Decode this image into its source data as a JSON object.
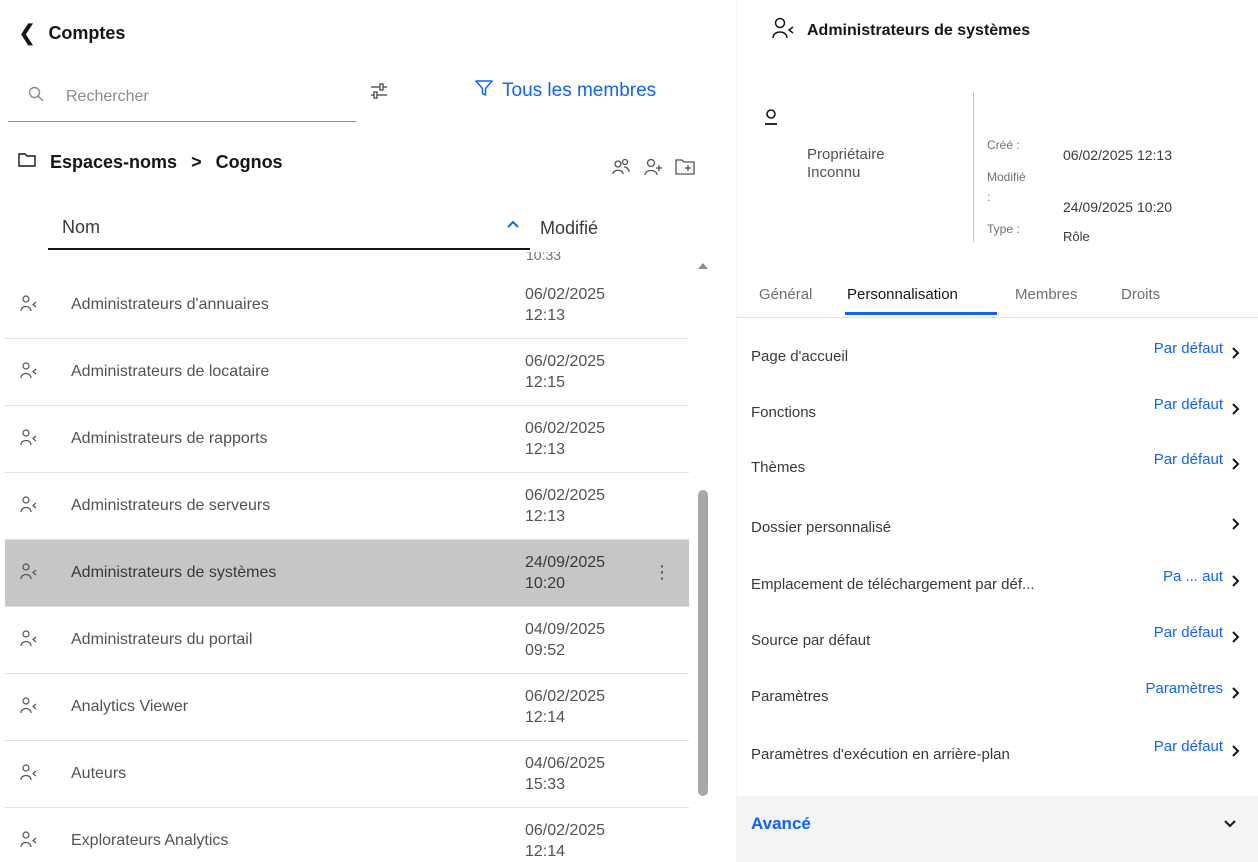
{
  "left": {
    "title": "Comptes",
    "search_placeholder": "Rechercher",
    "members_filter": "Tous les membres",
    "breadcrumb": {
      "root": "Espaces-noms",
      "separator": ">",
      "current": "Cognos"
    },
    "columns": {
      "name": "Nom",
      "modified": "Modifié"
    },
    "clipped_prev_time": "10:33",
    "rows": [
      {
        "name": "Administrateurs d'annuaires",
        "date": "06/02/2025",
        "time": "12:13"
      },
      {
        "name": "Administrateurs de locataire",
        "date": "06/02/2025",
        "time": "12:15"
      },
      {
        "name": "Administrateurs de rapports",
        "date": "06/02/2025",
        "time": "12:13"
      },
      {
        "name": "Administrateurs de serveurs",
        "date": "06/02/2025",
        "time": "12:13"
      },
      {
        "name": "Administrateurs de systèmes",
        "date": "24/09/2025",
        "time": "10:20",
        "selected": true
      },
      {
        "name": "Administrateurs du portail",
        "date": "04/09/2025",
        "time": "09:52"
      },
      {
        "name": "Analytics Viewer",
        "date": "06/02/2025",
        "time": "12:14"
      },
      {
        "name": "Auteurs",
        "date": "04/06/2025",
        "time": "15:33"
      },
      {
        "name": "Explorateurs Analytics",
        "date": "06/02/2025",
        "time": "12:14"
      }
    ]
  },
  "right": {
    "title": "Administrateurs de systèmes",
    "owner_label": "Propriétaire",
    "owner_value": "Inconnu",
    "created_label": "Créé :",
    "created_value": "06/02/2025 12:13",
    "modified_label": "Modifié",
    "modified_colon": ":",
    "modified_value": "24/09/2025 10:20",
    "type_label": "Type :",
    "type_value": "Rôle",
    "tabs": [
      "Général",
      "Personnalisation",
      "Membres",
      "Droits"
    ],
    "properties": [
      {
        "label": "Page d'accueil",
        "value": "Par défaut"
      },
      {
        "label": "Fonctions",
        "value": "Par défaut"
      },
      {
        "label": "Thèmes",
        "value": "Par défaut"
      },
      {
        "label": "Dossier personnalisé",
        "value": ""
      },
      {
        "label": "Emplacement de téléchargement par déf...",
        "value": "Pa ... aut"
      },
      {
        "label": "Source par défaut",
        "value": "Par défaut"
      },
      {
        "label": "Paramètres",
        "value": "Paramètres"
      },
      {
        "label": "Paramètres d'exécution en arrière-plan",
        "value": "Par défaut"
      }
    ],
    "advanced": "Avancé"
  },
  "colors": {
    "accent": "#0f62fe",
    "selected_row": "#c6c6c6",
    "panel_gray": "#f4f4f4"
  },
  "icons": [
    "chevron-left-icon",
    "search-icon",
    "filter-settings-icon",
    "funnel-icon",
    "folder-icon",
    "members-icon",
    "add-user-icon",
    "add-folder-icon",
    "sort-up-icon",
    "role-icon",
    "overflow-menu-icon",
    "owner-icon",
    "chevron-right-icon",
    "chevron-down-icon"
  ]
}
